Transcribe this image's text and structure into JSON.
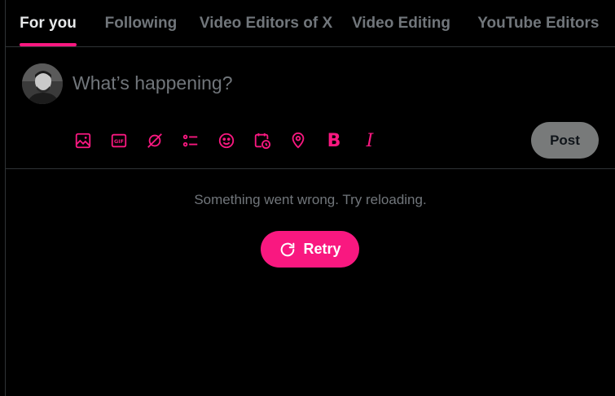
{
  "tabs": [
    {
      "label": "For you",
      "active": true
    },
    {
      "label": "Following",
      "active": false
    },
    {
      "label": "Video Editors of X",
      "active": false
    },
    {
      "label": "Video Editing",
      "active": false
    },
    {
      "label": "YouTube Editors",
      "active": false
    }
  ],
  "composer": {
    "placeholder": "What’s happening?",
    "post_label": "Post",
    "tools": [
      "media-icon",
      "gif-icon",
      "grok-icon",
      "poll-icon",
      "emoji-icon",
      "schedule-icon",
      "location-icon",
      "bold-icon",
      "italic-icon"
    ],
    "bold_glyph": "B",
    "italic_glyph": "I"
  },
  "error": {
    "message": "Something went wrong. Try reloading.",
    "retry_label": "Retry"
  },
  "colors": {
    "accent": "#f91880",
    "background": "#000000",
    "muted_text": "#71767b",
    "post_button": "#787a7a"
  }
}
